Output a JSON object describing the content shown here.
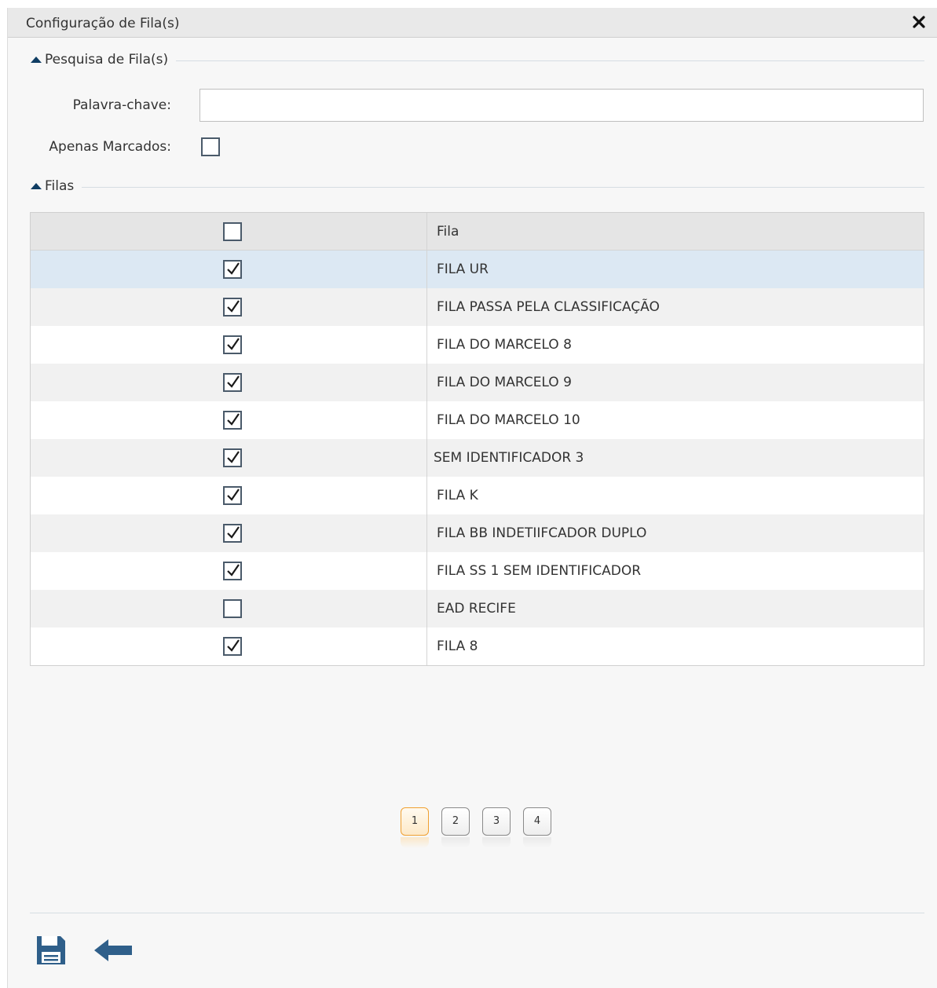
{
  "dialog": {
    "title": "Configuração de Fila(s)"
  },
  "search_section": {
    "title": "Pesquisa de Fila(s)",
    "keyword_label": "Palavra-chave:",
    "keyword_value": "",
    "only_marked_label": "Apenas Marcados:",
    "only_marked_checked": false
  },
  "queues_section": {
    "title": "Filas",
    "column_header": "Fila",
    "header_checked": false,
    "rows": [
      {
        "name": "FILA UR",
        "checked": true
      },
      {
        "name": "FILA PASSA PELA CLASSIFICAÇÃO",
        "checked": true
      },
      {
        "name": "FILA DO MARCELO 8",
        "checked": true
      },
      {
        "name": "FILA DO MARCELO 9",
        "checked": true
      },
      {
        "name": "FILA DO MARCELO 10",
        "checked": true
      },
      {
        "name": "SEM IDENTIFICADOR 3",
        "checked": true
      },
      {
        "name": "FILA K",
        "checked": true
      },
      {
        "name": "FILA BB INDETIIFCADOR DUPLO",
        "checked": true
      },
      {
        "name": "FILA SS 1  SEM IDENTIFICADOR",
        "checked": true
      },
      {
        "name": "EAD RECIFE",
        "checked": false
      },
      {
        "name": "FILA 8",
        "checked": true
      }
    ]
  },
  "pagination": {
    "pages": [
      "1",
      "2",
      "3",
      "4"
    ],
    "current": "1"
  },
  "icons": {
    "close": "close-icon",
    "save": "save-icon",
    "back": "back-arrow-icon",
    "collapse": "collapse-triangle-icon"
  },
  "colors": {
    "icon_blue": "#2f5f8a",
    "selected_row": "#dce8f3",
    "active_page": "#f0a030"
  }
}
